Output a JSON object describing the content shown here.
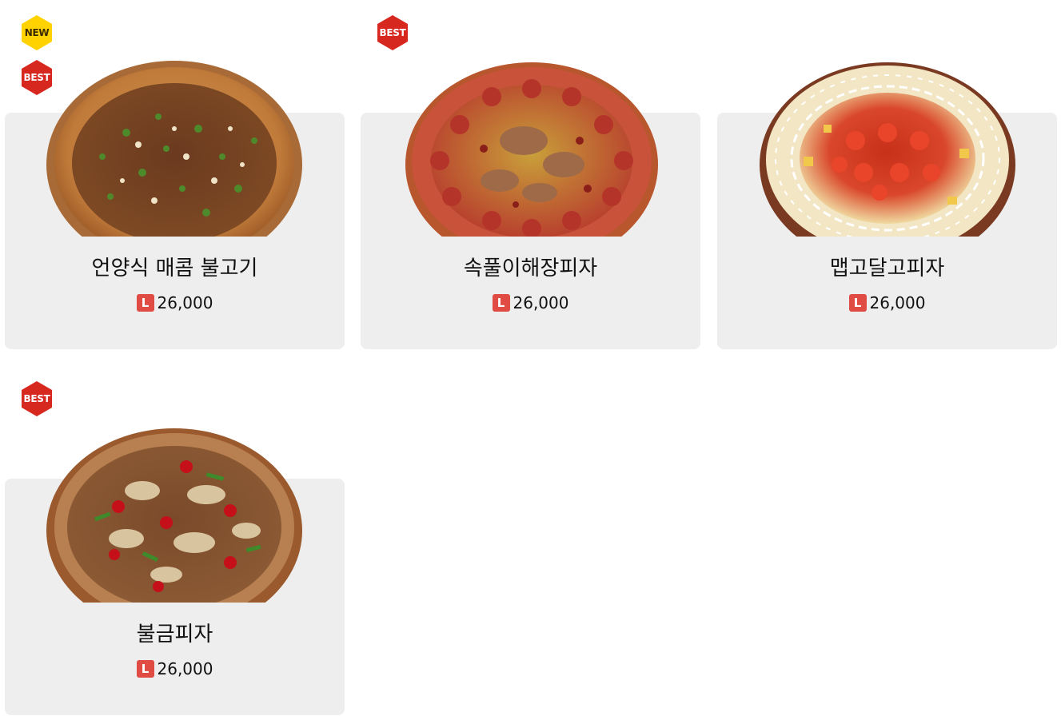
{
  "colors": {
    "card_bg": "#eeeeee",
    "badge_new": "#ffd200",
    "badge_best": "#d7281f",
    "size_badge": "#e04b43"
  },
  "products": [
    {
      "name": "언양식 매콤 불고기",
      "badges": [
        "NEW",
        "BEST"
      ],
      "size": "L",
      "price": "26,000",
      "image": "pizza-bulgogi-image"
    },
    {
      "name": "속풀이해장피자",
      "badges": [
        "BEST"
      ],
      "size": "L",
      "price": "26,000",
      "image": "pizza-sausage-image"
    },
    {
      "name": "맵고달고피자",
      "badges": [],
      "size": "L",
      "price": "26,000",
      "image": "pizza-shrimp-image"
    },
    {
      "name": "불금피자",
      "badges": [
        "BEST"
      ],
      "size": "L",
      "price": "26,000",
      "image": "pizza-bulgeum-image"
    }
  ]
}
